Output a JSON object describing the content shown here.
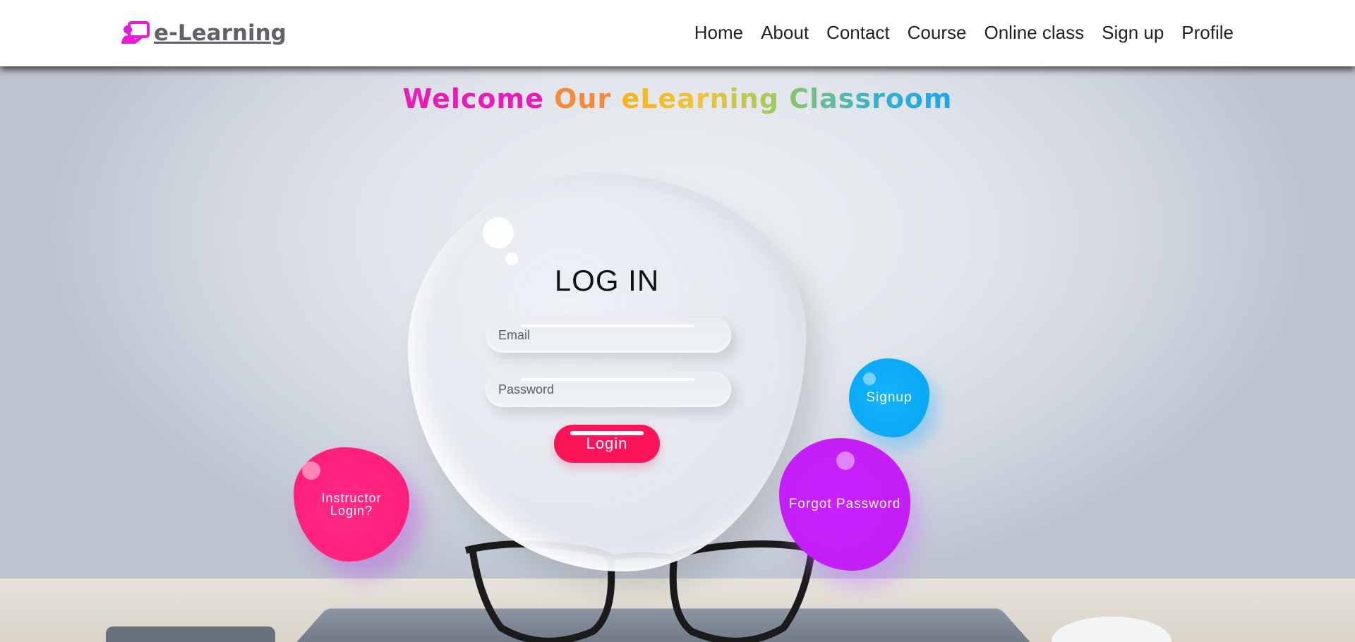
{
  "brand": {
    "name": "e-Learning",
    "icon": "teacher-board-icon",
    "icon_color": "#e91ad6"
  },
  "nav": {
    "links": [
      "Home",
      "About",
      "Contact",
      "Course",
      "Online class",
      "Sign up",
      "Profile"
    ]
  },
  "headline": {
    "words": [
      "Welcome",
      "Our",
      "eLearning",
      "Classroom"
    ]
  },
  "login": {
    "title": "LOG IN",
    "email_placeholder": "Email",
    "password_placeholder": "Password",
    "button_label": "Login"
  },
  "blobs": {
    "instructor_label_line1": "Instructor",
    "instructor_label_line2": "Login?",
    "signup_label": "Signup",
    "forgot_label": "Forgot Password"
  },
  "colors": {
    "login_button": "#fc1459",
    "instructor_blob": "#ff1f7c",
    "signup_blob": "#0aa8f6",
    "forgot_blob": "#c31ef6"
  }
}
